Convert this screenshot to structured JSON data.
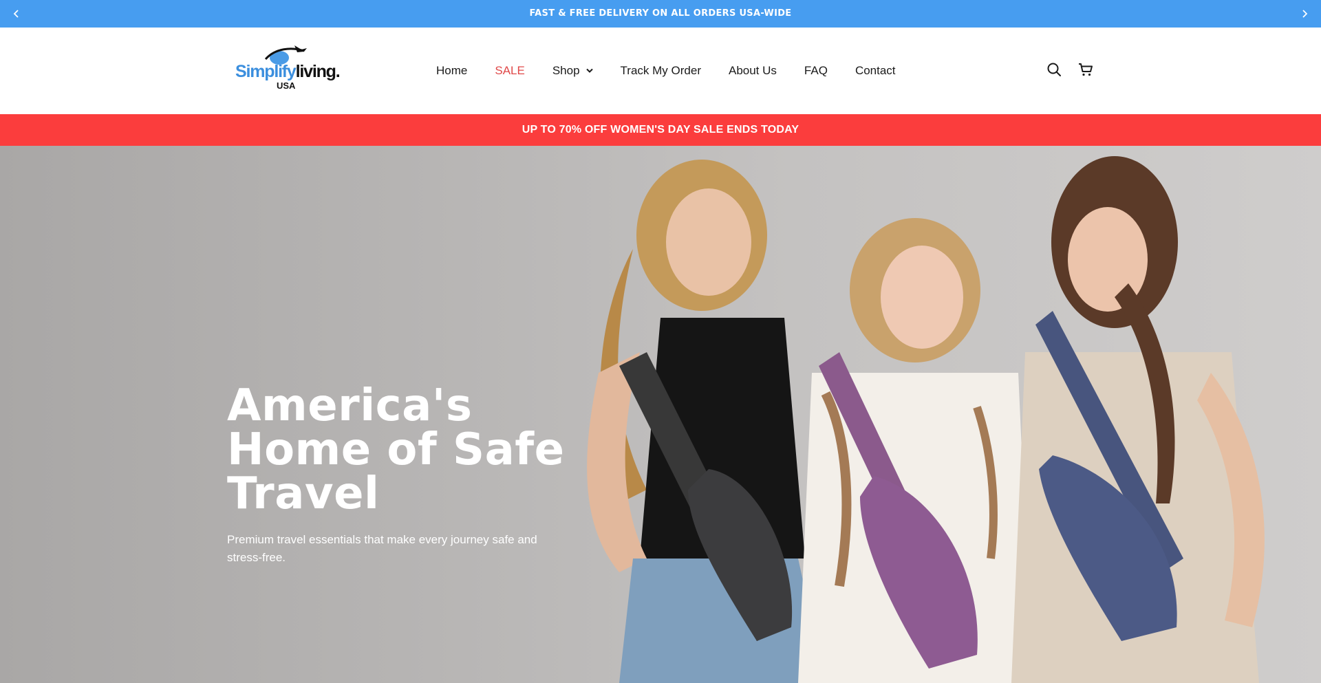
{
  "announcement": {
    "message": "FAST & FREE DELIVERY ON ALL ORDERS USA-WIDE",
    "prev_icon": "chevron-left-icon",
    "next_icon": "chevron-right-icon"
  },
  "brand": {
    "name_part1": "Simplify",
    "name_part2": "living.",
    "sub": "USA",
    "primary_color": "#3c8fde"
  },
  "nav": {
    "items": [
      {
        "label": "Home"
      },
      {
        "label": "SALE",
        "color": "#e04848"
      },
      {
        "label": "Shop",
        "has_dropdown": true
      },
      {
        "label": "Track My Order"
      },
      {
        "label": "About Us"
      },
      {
        "label": "FAQ"
      },
      {
        "label": "Contact"
      }
    ]
  },
  "header_icons": [
    "search-icon",
    "cart-icon"
  ],
  "sale_banner": {
    "text": "UP TO 70% OFF WOMEN'S DAY SALE ENDS TODAY",
    "color": "#fb3d3d"
  },
  "hero": {
    "title": "America's Home of Safe Travel",
    "description": "Premium travel essentials that make every journey safe and stress-free."
  },
  "colors": {
    "announce_bg": "#479df0",
    "sale_bg": "#fb3d3d"
  }
}
